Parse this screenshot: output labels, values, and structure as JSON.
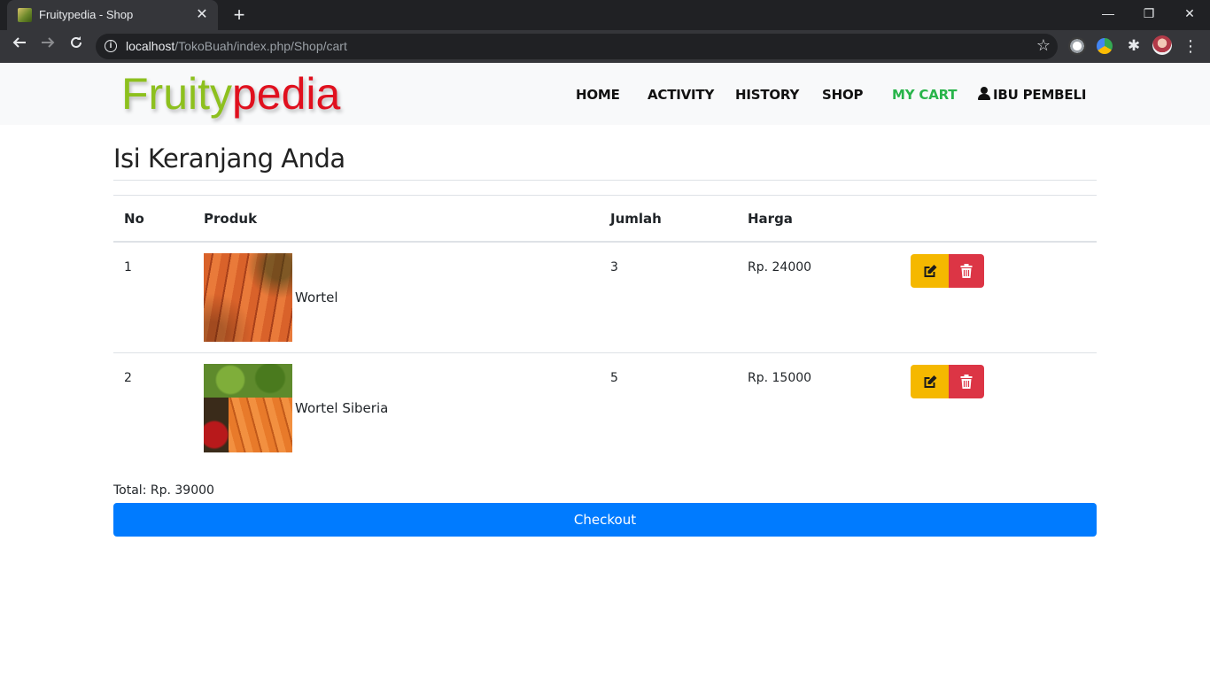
{
  "browser": {
    "tab_title": "Fruitypedia - Shop",
    "url_host": "localhost",
    "url_path": "/TokoBuah/index.php/Shop/cart"
  },
  "brand": {
    "part1": "Fruity",
    "part2": "pedia",
    "color1": "#8dc01e",
    "color2": "#e0101e"
  },
  "nav": {
    "home": "HOME",
    "activity": "ACTIVITY",
    "history": "HISTORY",
    "shop": "SHOP",
    "cart": "MY CART",
    "user": "IBU PEMBELI",
    "active_color": "#28b44a"
  },
  "cart": {
    "heading": "Isi Keranjang Anda",
    "columns": {
      "no": "No",
      "product": "Produk",
      "qty": "Jumlah",
      "price": "Harga"
    },
    "items": [
      {
        "no": "1",
        "name": "Wortel",
        "qty": "3",
        "price": "Rp. 24000",
        "image": "carrot-image"
      },
      {
        "no": "2",
        "name": "Wortel Siberia",
        "qty": "5",
        "price": "Rp. 15000",
        "image": "vegetables-image"
      }
    ],
    "total": "Total: Rp. 39000",
    "checkout_label": "Checkout",
    "colors": {
      "edit": "#f5b800",
      "delete": "#dc3545",
      "checkout": "#007bff"
    },
    "icons": {
      "edit": "edit-icon",
      "delete": "trash-icon"
    }
  }
}
